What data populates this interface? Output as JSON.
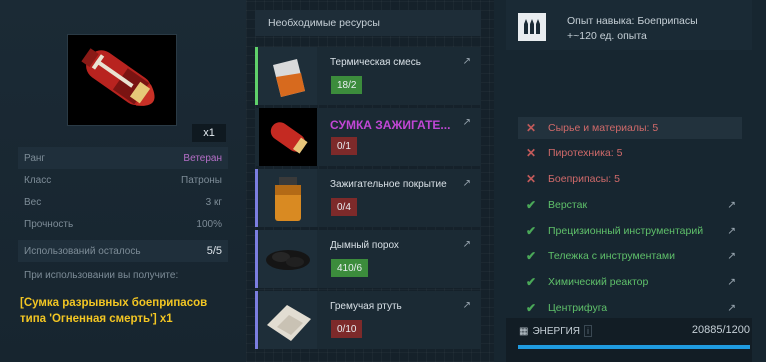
{
  "item": {
    "quantity": "x1",
    "stats": [
      {
        "key": "Ранг",
        "value": "Ветеран"
      },
      {
        "key": "Класс",
        "value": "Патроны"
      },
      {
        "key": "Вес",
        "value": "3 кг"
      },
      {
        "key": "Прочность",
        "value": "100%"
      }
    ],
    "uses_label": "Использований осталось",
    "uses_value": "5/5",
    "gets_label": "При использовании вы получите:",
    "result": "[Сумка разрывных боеприпасов типа 'Огненная смерть'] x1"
  },
  "resources": {
    "header": "Необходимые ресурсы",
    "items": [
      {
        "name": "Термическая смесь",
        "count": "18/2",
        "status": "ok"
      },
      {
        "name": "СУМКА ЗАЖИГАТЕ...",
        "count": "0/1",
        "status": "bad"
      },
      {
        "name": "Зажигательное покрытие",
        "count": "0/4",
        "status": "bad"
      },
      {
        "name": "Дымный порох",
        "count": "410/6",
        "status": "ok"
      },
      {
        "name": "Гремучая ртуть",
        "count": "0/10",
        "status": "bad"
      }
    ]
  },
  "skill": {
    "title": "Опыт навыка: Боеприпасы",
    "exp": "+~120 ед. опыта"
  },
  "requirements": [
    {
      "label": "Сырье и материалы: 5",
      "ok": false,
      "link": false
    },
    {
      "label": "Пиротехника: 5",
      "ok": false,
      "link": false
    },
    {
      "label": "Боеприпасы: 5",
      "ok": false,
      "link": false
    },
    {
      "label": "Верстак",
      "ok": true,
      "link": true
    },
    {
      "label": "Прецизионный инструментарий",
      "ok": true,
      "link": true
    },
    {
      "label": "Тележка с инструментами",
      "ok": true,
      "link": true
    },
    {
      "label": "Химический реактор",
      "ok": true,
      "link": true
    },
    {
      "label": "Центрифуга",
      "ok": true,
      "link": true
    }
  ],
  "energy": {
    "label": "ЭНЕРГИЯ",
    "value": "20885/1200",
    "fill_fraction": 1.0
  },
  "colors": {
    "ok": "#3c8c3c",
    "bad": "#7d2a2a",
    "rank": "#b56fc7",
    "result": "#f3c623",
    "energy": "#1f9be0"
  }
}
